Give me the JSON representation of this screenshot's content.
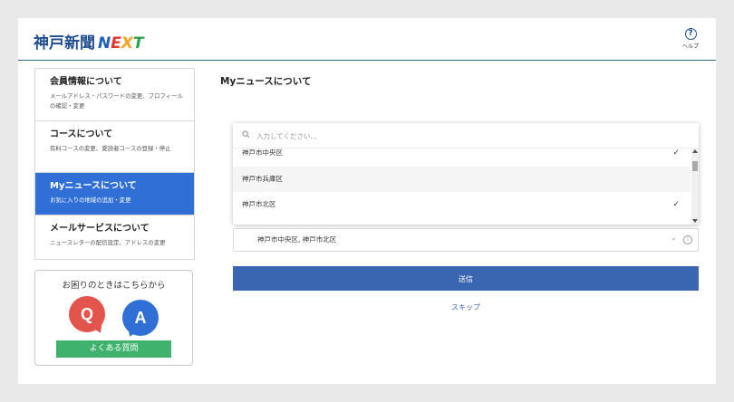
{
  "header": {
    "logo_jp": "神戸新聞",
    "logo_n": "N",
    "logo_e": "E",
    "logo_x": "X",
    "logo_t": "T",
    "help_label": "ヘルプ",
    "help_icon": "question-circle-icon"
  },
  "sidebar": {
    "items": [
      {
        "title": "会員情報について",
        "desc": "メールアドレス・パスワードの変更、プロフィールの確認・変更"
      },
      {
        "title": "コースについて",
        "desc": "有料コースの変更、愛読者コースの登録・停止"
      },
      {
        "title": "Myニュースについて",
        "desc": "お気に入りの地域の追加・変更"
      },
      {
        "title": "メールサービスについて",
        "desc": "ニュースレターの配信設定、アドレスの変更"
      }
    ]
  },
  "qa": {
    "title": "お困りのときはこちらから",
    "q": "Q",
    "a": "A",
    "faq_label": "よくある質問"
  },
  "main": {
    "title": "Myニュースについて",
    "search_placeholder": "入力してください...",
    "options": [
      {
        "label": "神戸市中央区",
        "checked": true
      },
      {
        "label": "神戸市兵庫区",
        "checked": false
      },
      {
        "label": "神戸市北区",
        "checked": true
      }
    ],
    "check_mark": "✓",
    "selected_value": "神戸市中央区, 神戸市北区",
    "submit_label": "送信",
    "skip_label": "スキップ"
  },
  "colors": {
    "accent_blue": "#2f6fd6",
    "button_blue": "#3a65b0",
    "faq_green": "#3fb36e",
    "q_red": "#e2544c"
  }
}
